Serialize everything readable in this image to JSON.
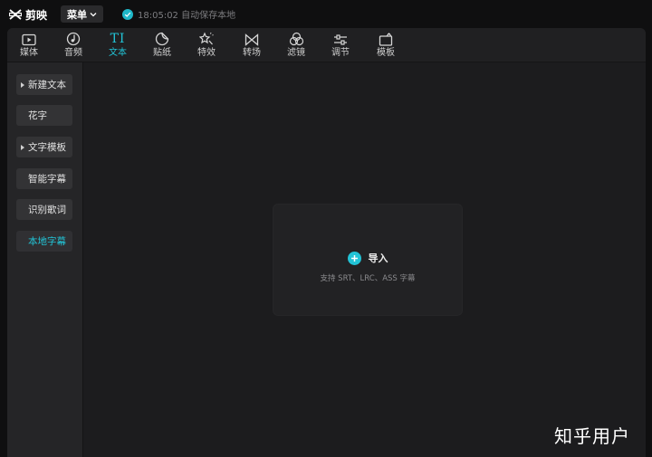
{
  "app": {
    "name": "剪映",
    "menu_label": "菜单",
    "save_status": "18:05:02 自动保存本地"
  },
  "toolbar": {
    "tabs": [
      {
        "label": "媒体",
        "icon": "media-icon",
        "active": false
      },
      {
        "label": "音频",
        "icon": "audio-icon",
        "active": false
      },
      {
        "label": "文本",
        "icon": "text-icon",
        "active": true
      },
      {
        "label": "贴纸",
        "icon": "sticker-icon",
        "active": false
      },
      {
        "label": "特效",
        "icon": "effects-icon",
        "active": false
      },
      {
        "label": "转场",
        "icon": "transition-icon",
        "active": false
      },
      {
        "label": "滤镜",
        "icon": "filter-icon",
        "active": false
      },
      {
        "label": "调节",
        "icon": "adjust-icon",
        "active": false
      },
      {
        "label": "模板",
        "icon": "template-icon",
        "active": false
      }
    ]
  },
  "sidebar": {
    "items": [
      {
        "label": "新建文本",
        "expandable": true,
        "active": false
      },
      {
        "label": "花字",
        "expandable": false,
        "active": false
      },
      {
        "label": "文字模板",
        "expandable": true,
        "active": false
      },
      {
        "label": "智能字幕",
        "expandable": false,
        "active": false
      },
      {
        "label": "识别歌词",
        "expandable": false,
        "active": false
      },
      {
        "label": "本地字幕",
        "expandable": false,
        "active": true
      }
    ]
  },
  "import": {
    "label": "导入",
    "hint": "支持 SRT、LRC、ASS 字幕"
  },
  "watermark": "知乎用户",
  "colors": {
    "accent": "#22c3d6",
    "background": "#1c1c1e",
    "sidebar": "#252527"
  }
}
